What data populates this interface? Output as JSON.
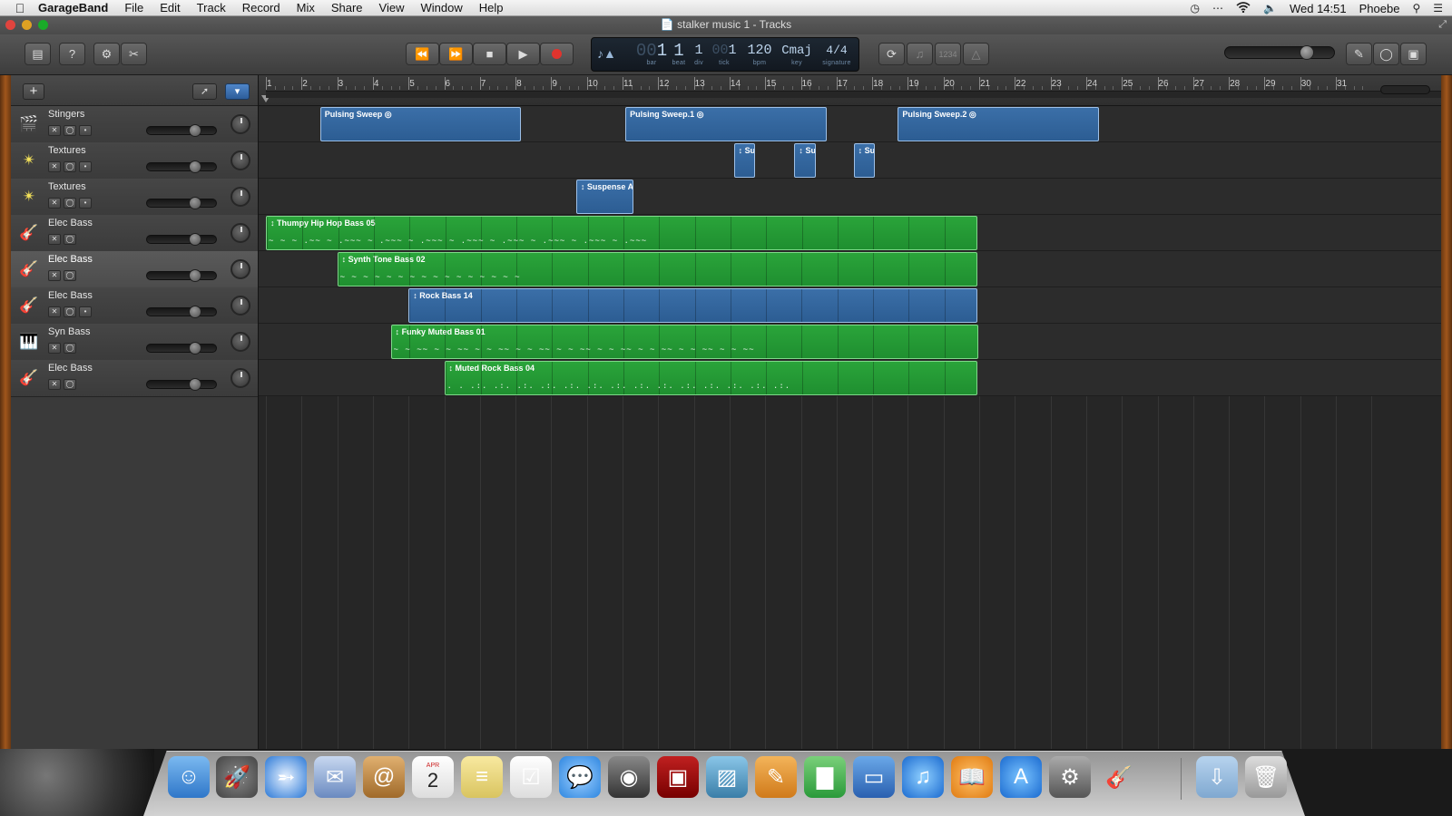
{
  "menubar": {
    "app": "GarageBand",
    "menus": [
      "File",
      "Edit",
      "Track",
      "Record",
      "Mix",
      "Share",
      "View",
      "Window",
      "Help"
    ],
    "clock": "Wed 14:51",
    "user": "Phoebe"
  },
  "window": {
    "title": "stalker music 1 - Tracks"
  },
  "lcd": {
    "bar": "1",
    "beat": "1",
    "div": "1",
    "tick": "1",
    "bar_ghost": "00",
    "tick_ghost": "00",
    "tempo": "120",
    "key": "Cmaj",
    "signature": "4/4",
    "labels": {
      "bar": "bar",
      "beat": "beat",
      "div": "div",
      "tick": "tick",
      "bpm": "bpm",
      "key": "key",
      "signature": "signature"
    }
  },
  "toolbar": {
    "count_in": "1234"
  },
  "ruler": {
    "bars": [
      "1",
      "2",
      "3",
      "4",
      "5",
      "6",
      "7",
      "8",
      "9",
      "10",
      "11",
      "12",
      "13",
      "14",
      "15",
      "16",
      "17",
      "18",
      "19",
      "20",
      "21",
      "22",
      "23",
      "24",
      "25",
      "26",
      "27",
      "28",
      "29",
      "30",
      "31"
    ]
  },
  "tracks": [
    {
      "name": "Stingers",
      "icon": "stingers-icon",
      "selected": false
    },
    {
      "name": "Textures",
      "icon": "textures-icon",
      "selected": false
    },
    {
      "name": "Textures",
      "icon": "textures-icon",
      "selected": false
    },
    {
      "name": "Elec Bass",
      "icon": "bass-guitar-icon",
      "selected": false
    },
    {
      "name": "Elec Bass",
      "icon": "bass-guitar-icon",
      "selected": true
    },
    {
      "name": "Elec Bass",
      "icon": "bass-guitar-icon",
      "selected": false
    },
    {
      "name": "Syn Bass",
      "icon": "synth-keyboard-icon",
      "selected": false
    },
    {
      "name": "Elec Bass",
      "icon": "bass-guitar-icon",
      "selected": false
    }
  ],
  "regions": [
    {
      "label": "Pulsing Sweep",
      "track": 0,
      "color": "blue"
    },
    {
      "label": "Pulsing Sweep.1",
      "track": 0,
      "color": "blue"
    },
    {
      "label": "Pulsing Sweep.2",
      "track": 0,
      "color": "blue"
    },
    {
      "label": "Su",
      "track": 1,
      "color": "blue"
    },
    {
      "label": "Su",
      "track": 1,
      "color": "blue"
    },
    {
      "label": "Su",
      "track": 1,
      "color": "blue"
    },
    {
      "label": "Suspense A",
      "track": 2,
      "color": "blue"
    },
    {
      "label": "Thumpy Hip Hop Bass 05",
      "track": 3,
      "color": "green"
    },
    {
      "label": "Synth Tone Bass 02",
      "track": 4,
      "color": "green"
    },
    {
      "label": "Rock Bass 14",
      "track": 5,
      "color": "blue"
    },
    {
      "label": "Funky Muted Bass 01",
      "track": 6,
      "color": "green"
    },
    {
      "label": "Muted Rock Bass 04",
      "track": 7,
      "color": "green"
    }
  ],
  "colors": {
    "region_blue": "#3b6fa8",
    "region_green": "#2aa43a",
    "record": "#e0342e"
  },
  "dock": {
    "apps": [
      "finder-icon",
      "launchpad-icon",
      "safari-icon",
      "mail-icon",
      "contacts-icon",
      "calendar-icon",
      "notes-icon",
      "reminders-icon",
      "messages-icon",
      "facetime-icon",
      "photo-booth-icon",
      "iphoto-icon",
      "pages-icon",
      "numbers-icon",
      "keynote-icon",
      "itunes-icon",
      "ibooks-icon",
      "app-store-icon",
      "system-preferences-icon",
      "garageband-icon",
      "downloads-folder-icon",
      "trash-icon"
    ],
    "calendar_day": "2",
    "calendar_month": "APR"
  }
}
